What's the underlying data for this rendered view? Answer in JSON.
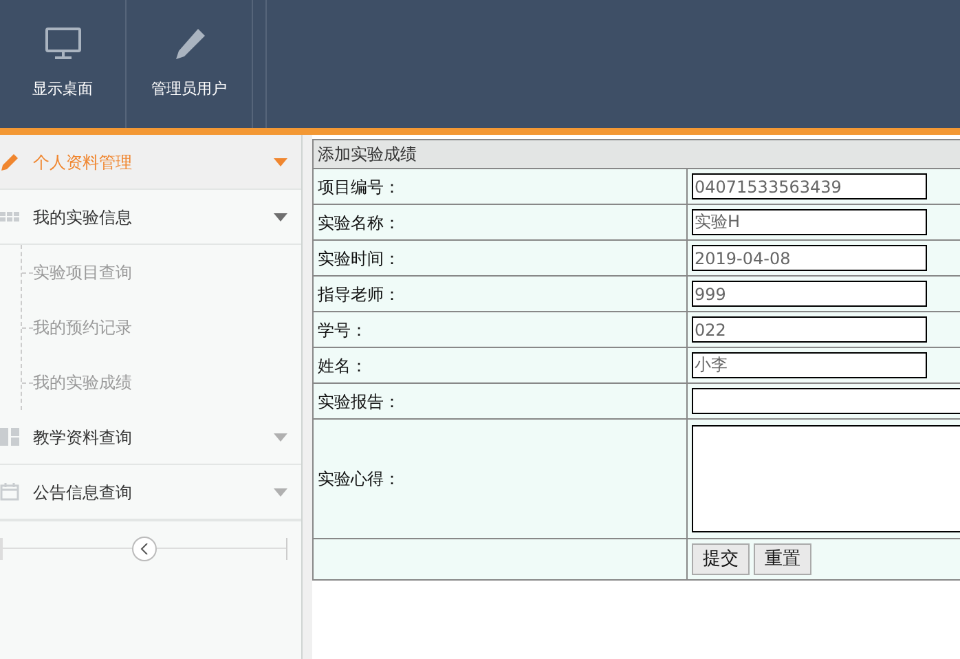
{
  "header": {
    "nav": [
      {
        "kind": "monitor",
        "label": "显示桌面"
      },
      {
        "kind": "pencil",
        "label": "管理员用户"
      }
    ]
  },
  "sidebar": {
    "items": [
      {
        "kind": "pencil",
        "label": "个人资料管理",
        "selected": true,
        "expanded": false
      },
      {
        "kind": "grid",
        "label": "我的实验信息",
        "selected": false,
        "expanded": true,
        "children": [
          {
            "label": "实验项目查询"
          },
          {
            "label": "我的预约记录"
          },
          {
            "label": "我的实验成绩"
          }
        ]
      },
      {
        "kind": "tiles",
        "label": "教学资料查询",
        "selected": false,
        "expanded": false
      },
      {
        "kind": "calendar",
        "label": "公告信息查询",
        "selected": false,
        "expanded": false
      }
    ]
  },
  "form": {
    "title": "添加实验成绩",
    "fields": [
      {
        "kind": "input",
        "label": "项目编号：",
        "value": "04071533563439"
      },
      {
        "kind": "input",
        "label": "实验名称：",
        "value": "实验H"
      },
      {
        "kind": "input",
        "label": "实验时间：",
        "value": "2019-04-08"
      },
      {
        "kind": "input",
        "label": "指导老师：",
        "value": "999"
      },
      {
        "kind": "input",
        "label": "学号：",
        "value": "022"
      },
      {
        "kind": "input",
        "label": "姓名：",
        "value": "小李"
      },
      {
        "kind": "wide",
        "label": "实验报告："
      },
      {
        "kind": "textarea",
        "label": "实验心得："
      }
    ],
    "buttons": [
      "提交",
      "重置"
    ]
  }
}
